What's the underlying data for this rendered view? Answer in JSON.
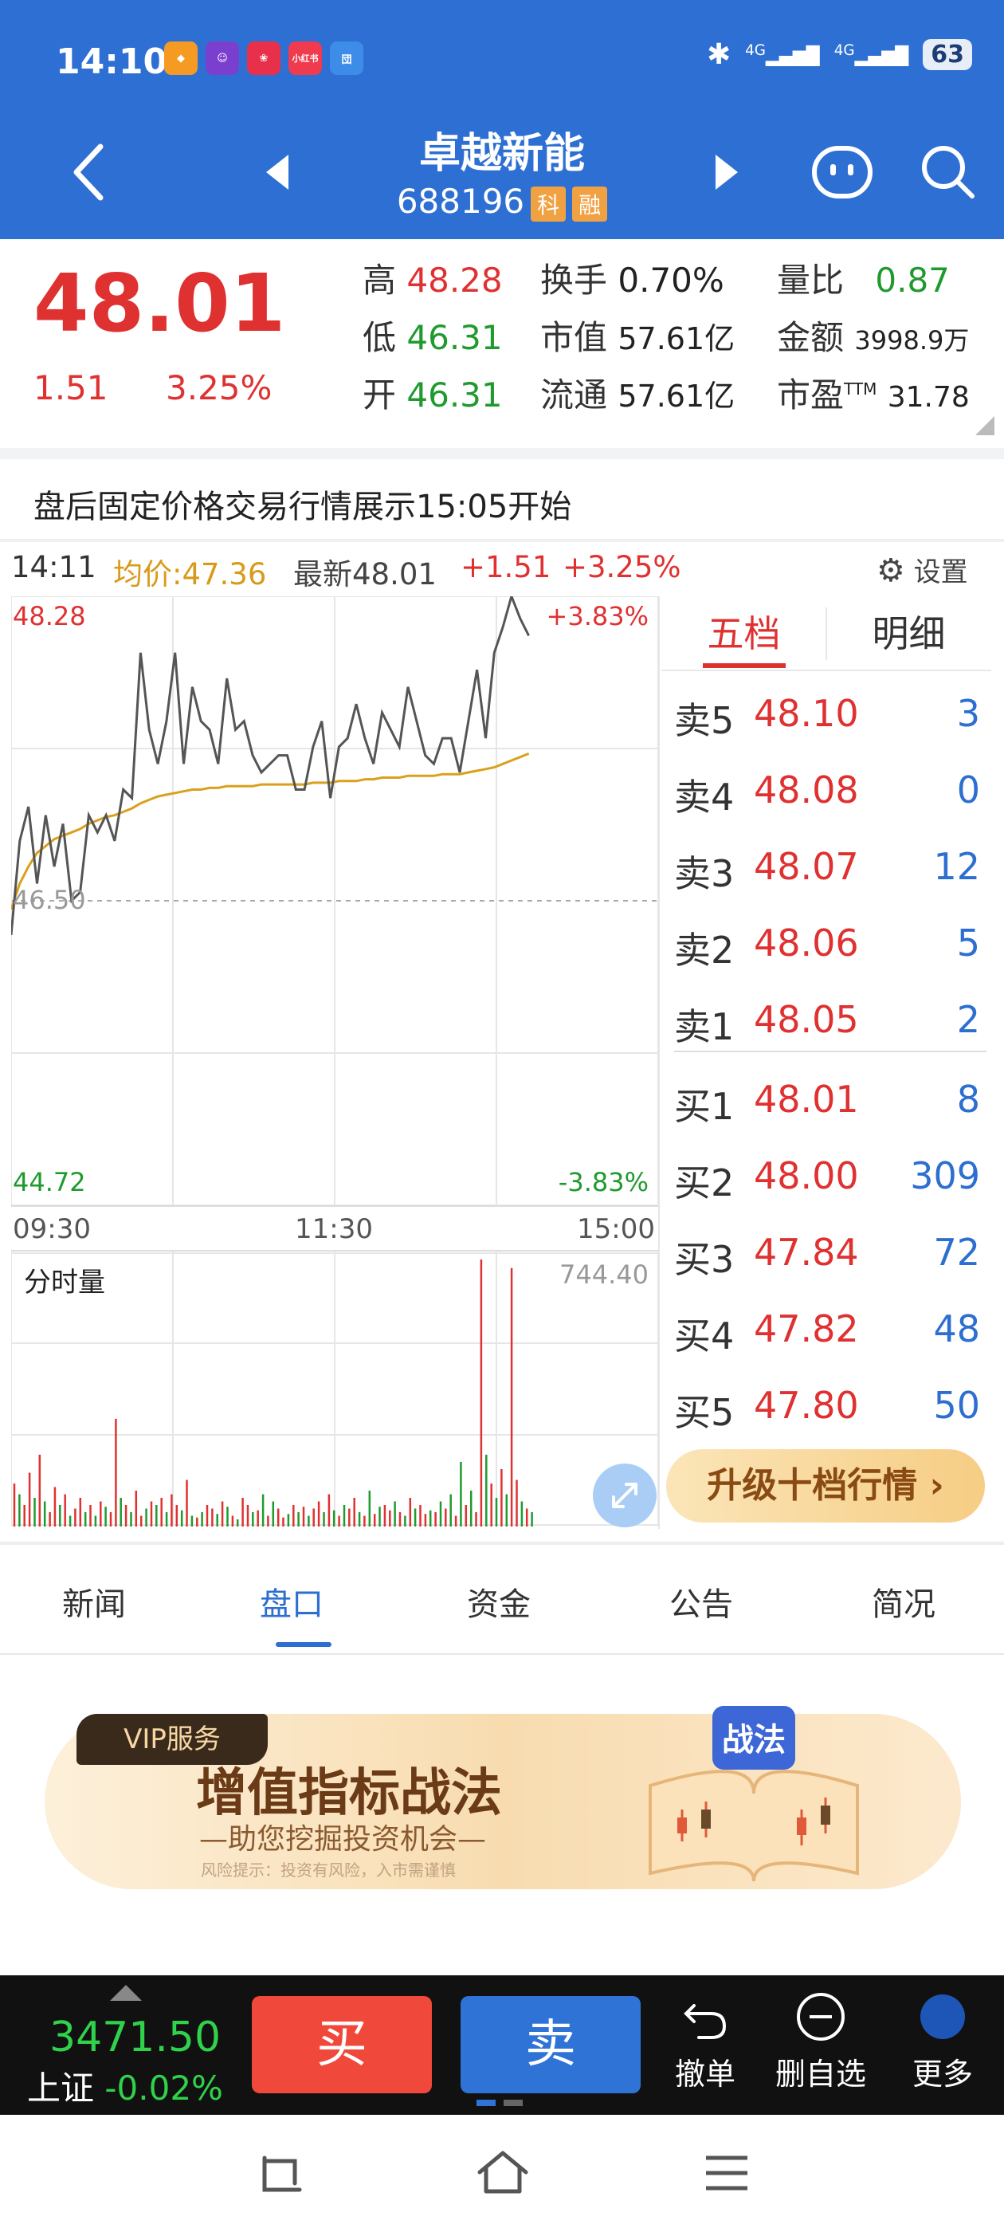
{
  "status_bar": {
    "time": "14:10",
    "battery": "63",
    "net1": "4G",
    "net2": "4G",
    "app_icon_label": "小红书"
  },
  "header": {
    "title": "卓越新能",
    "code": "688196",
    "tag1": "科",
    "tag2": "融"
  },
  "quote": {
    "price": "48.01",
    "change": "1.51",
    "change_pct": "3.25%",
    "high_label": "高",
    "high": "48.28",
    "low_label": "低",
    "low": "46.31",
    "open_label": "开",
    "open": "46.31",
    "turnover_label": "换手",
    "turnover": "0.70%",
    "mktcap_label": "市值",
    "mktcap": "57.61亿",
    "float_label": "流通",
    "float": "57.61亿",
    "volratio_label": "量比",
    "volratio": "0.87",
    "amount_label": "金额",
    "amount": "3998.9万",
    "pe_label": "市盈",
    "pe_sup": "TTM",
    "pe": "31.78"
  },
  "notice": "盘后固定价格交易行情展示15:05开始",
  "chart_header": {
    "time": "14:11",
    "avg": "均价:47.36",
    "latest": "最新48.01",
    "chg": "+1.51",
    "pct": "+3.25%",
    "settings": "设置"
  },
  "chart_data": {
    "type": "line",
    "x_ticks": [
      "09:30",
      "11:30",
      "15:00"
    ],
    "ylim": [
      44.72,
      48.28
    ],
    "y_labels": {
      "top": "48.28",
      "mid": "46.50",
      "bottom": "44.72"
    },
    "pct_labels": {
      "top": "+3.83%",
      "bottom": "-3.83%"
    },
    "colors": {
      "price": "#555555",
      "avg": "#d9a11b",
      "up": "#e03131",
      "down": "#1f9a2f"
    },
    "price": [
      46.3,
      46.85,
      47.05,
      46.6,
      47.0,
      46.7,
      46.95,
      46.5,
      46.55,
      47.0,
      46.9,
      47.0,
      46.85,
      47.15,
      47.1,
      47.95,
      47.5,
      47.3,
      47.55,
      47.95,
      47.3,
      47.75,
      47.55,
      47.5,
      47.3,
      47.8,
      47.5,
      47.55,
      47.35,
      47.25,
      47.3,
      47.35,
      47.35,
      47.15,
      47.15,
      47.4,
      47.55,
      47.1,
      47.4,
      47.45,
      47.65,
      47.45,
      47.3,
      47.6,
      47.5,
      47.4,
      47.75,
      47.55,
      47.35,
      47.3,
      47.45,
      47.45,
      47.25,
      47.55,
      47.85,
      47.45,
      47.95,
      48.1,
      48.28,
      48.15,
      48.05
    ],
    "avg": [
      46.45,
      46.6,
      46.7,
      46.78,
      46.82,
      46.86,
      46.88,
      46.9,
      46.92,
      46.95,
      46.97,
      46.99,
      47.0,
      47.02,
      47.04,
      47.07,
      47.09,
      47.11,
      47.12,
      47.13,
      47.14,
      47.15,
      47.15,
      47.16,
      47.16,
      47.17,
      47.17,
      47.17,
      47.17,
      47.18,
      47.18,
      47.18,
      47.18,
      47.18,
      47.18,
      47.19,
      47.19,
      47.19,
      47.2,
      47.2,
      47.2,
      47.21,
      47.21,
      47.22,
      47.22,
      47.22,
      47.23,
      47.23,
      47.23,
      47.23,
      47.24,
      47.24,
      47.24,
      47.25,
      47.26,
      47.27,
      47.28,
      47.3,
      47.32,
      47.34,
      47.36
    ],
    "volume_max_label": "744.40",
    "volume_title": "分时量",
    "volume": [
      120,
      90,
      60,
      150,
      80,
      200,
      70,
      40,
      110,
      60,
      90,
      30,
      50,
      80,
      40,
      60,
      30,
      70,
      55,
      40,
      300,
      80,
      60,
      40,
      100,
      30,
      50,
      70,
      60,
      80,
      40,
      90,
      60,
      45,
      130,
      30,
      25,
      40,
      60,
      50,
      35,
      70,
      55,
      30,
      20,
      80,
      60,
      40,
      45,
      90,
      30,
      70,
      50,
      25,
      35,
      60,
      40,
      55,
      30,
      50,
      70,
      40,
      90,
      45,
      30,
      60,
      50,
      80,
      40,
      30,
      100,
      35,
      55,
      60,
      45,
      70,
      40,
      30,
      80,
      50,
      60,
      35,
      45,
      40,
      70,
      50,
      90,
      30,
      180,
      60,
      100,
      40,
      744,
      200,
      120,
      80,
      160,
      90,
      720,
      130,
      70,
      50,
      40
    ],
    "volume_up": [
      1,
      0,
      1,
      1,
      0,
      1,
      0,
      1,
      1,
      0,
      1,
      0,
      1,
      1,
      0,
      1,
      0,
      1,
      0,
      1,
      1,
      0,
      1,
      0,
      1,
      1,
      0,
      1,
      0,
      1,
      0,
      1,
      1,
      0,
      1,
      0,
      1,
      0,
      1,
      1,
      0,
      1,
      0,
      1,
      0,
      1,
      1,
      0,
      1,
      0,
      1,
      0,
      1,
      1,
      0,
      1,
      0,
      1,
      0,
      1,
      1,
      0,
      1,
      0,
      1,
      0,
      1,
      1,
      0,
      1,
      0,
      1,
      0,
      1,
      1,
      0,
      1,
      0,
      1,
      0,
      1,
      1,
      0,
      1,
      0,
      1,
      0,
      1,
      0,
      1,
      0,
      1,
      1,
      0,
      1,
      0,
      1,
      0,
      1,
      1,
      0,
      1,
      0
    ]
  },
  "orderbook": {
    "tab_active": "五档",
    "tab_other": "明细",
    "rows": [
      {
        "label": "卖5",
        "price": "48.10",
        "vol": "3"
      },
      {
        "label": "卖4",
        "price": "48.08",
        "vol": "0"
      },
      {
        "label": "卖3",
        "price": "48.07",
        "vol": "12"
      },
      {
        "label": "卖2",
        "price": "48.06",
        "vol": "5"
      },
      {
        "label": "卖1",
        "price": "48.05",
        "vol": "2"
      },
      {
        "label": "买1",
        "price": "48.01",
        "vol": "8"
      },
      {
        "label": "买2",
        "price": "48.00",
        "vol": "309"
      },
      {
        "label": "买3",
        "price": "47.84",
        "vol": "72"
      },
      {
        "label": "买4",
        "price": "47.82",
        "vol": "48"
      },
      {
        "label": "买5",
        "price": "47.80",
        "vol": "50"
      }
    ],
    "upgrade": "升级十档行情 ›"
  },
  "tabs": [
    "新闻",
    "盘口",
    "资金",
    "公告",
    "简况"
  ],
  "banner": {
    "badge": "VIP服务",
    "title": "增值指标战法",
    "subtitle": "—助您挖掘投资机会—",
    "risk": "风险提示：投资有风险，入市需谨慎",
    "book_label": "战法"
  },
  "bottom": {
    "index_value": "3471.50",
    "index_name": "上证",
    "index_pct": "-0.02%",
    "buy": "买",
    "sell": "卖",
    "cancel": "撤单",
    "remove": "删自选",
    "more": "更多"
  }
}
